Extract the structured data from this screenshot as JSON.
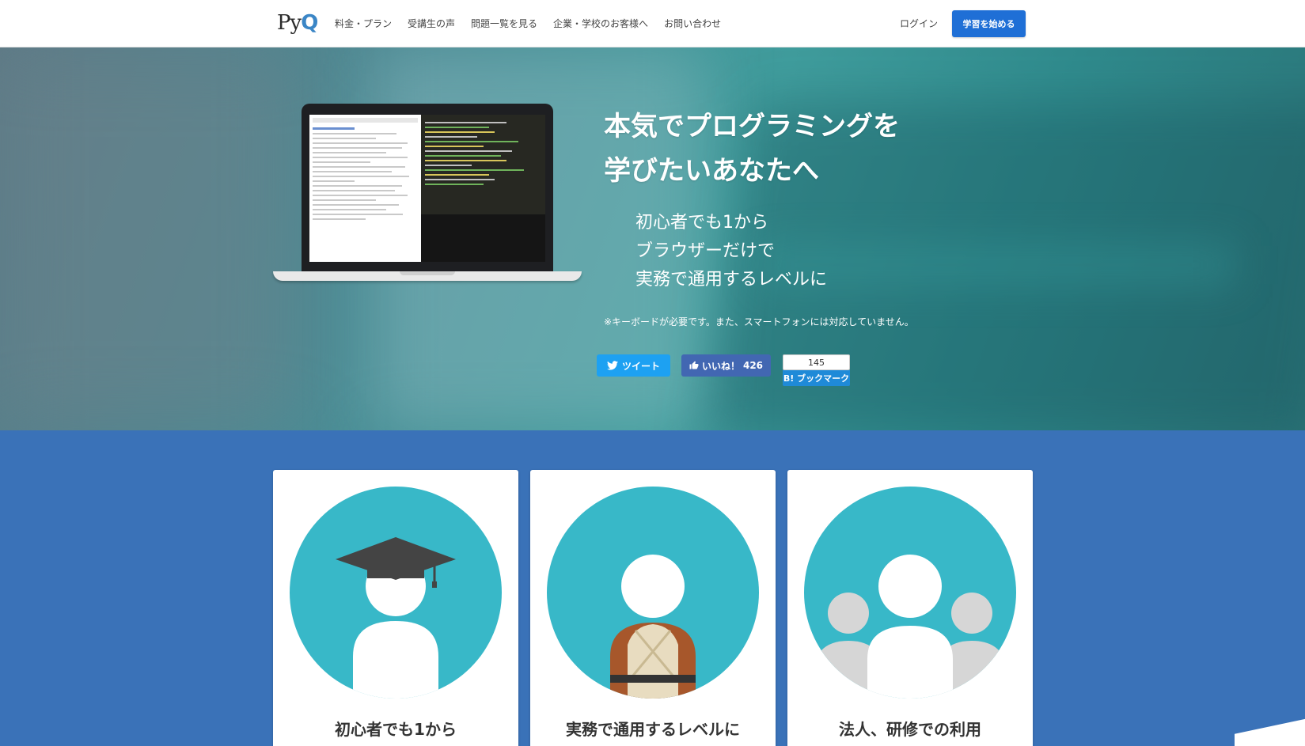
{
  "header": {
    "logo_text": "PyQ",
    "nav": [
      "料金・プラン",
      "受講生の声",
      "問題一覧を見る",
      "企業・学校のお客様へ",
      "お問い合わせ"
    ],
    "login": "ログイン",
    "start": "学習を始める"
  },
  "hero": {
    "title_line1": "本気でプログラミングを",
    "title_line2": "学びたいあなたへ",
    "sub_line1": "初心者でも1から",
    "sub_line2": "ブラウザーだけで",
    "sub_line3": "実務で通用するレベルに",
    "note": "※キーボードが必要です。また、スマートフォンには対応していません。"
  },
  "social": {
    "tweet": "ツイート",
    "like": "いいね！",
    "like_count": "426",
    "bookmark_count": "145",
    "bookmark": "B! ブックマーク"
  },
  "cards": [
    {
      "title": "初心者でも1から",
      "icon": "graduate-icon"
    },
    {
      "title": "実務で通用するレベルに",
      "icon": "professional-icon"
    },
    {
      "title": "法人、研修での利用",
      "icon": "group-icon"
    }
  ],
  "colors": {
    "accent": "#1f6fd6",
    "band": "#3a72b8",
    "circle": "#38b8c8",
    "twitter": "#1da1f2",
    "facebook": "#4267b2",
    "hatena": "#1f8ad8"
  }
}
